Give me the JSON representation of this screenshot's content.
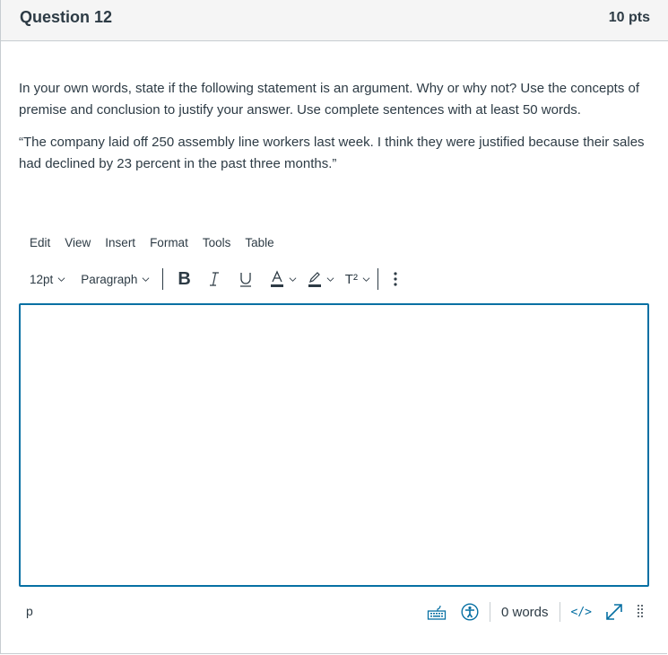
{
  "question": {
    "title": "Question 12",
    "points": "10 pts",
    "prompt": "In your own words, state if the following statement is an argument. Why or why not? Use the concepts of premise and conclusion to justify your answer. Use complete sentences with at least 50 words.",
    "quote": "“The company laid off 250 assembly line workers last week. I think they were justified because their sales had declined by 23 percent in the past three months.”"
  },
  "editor": {
    "menu": [
      "Edit",
      "View",
      "Insert",
      "Format",
      "Tools",
      "Table"
    ],
    "toolbar": {
      "font_size": "12pt",
      "block_format": "Paragraph",
      "bold": "B",
      "italic": "I",
      "underline": "U",
      "text_color": "A",
      "superscript": "T²"
    },
    "content": "",
    "status": {
      "path": "p",
      "word_count": "0 words",
      "html_toggle": "</>"
    },
    "colors": {
      "accent": "#0770a3",
      "text": "#2d3b45",
      "border": "#c7cdd1"
    }
  }
}
